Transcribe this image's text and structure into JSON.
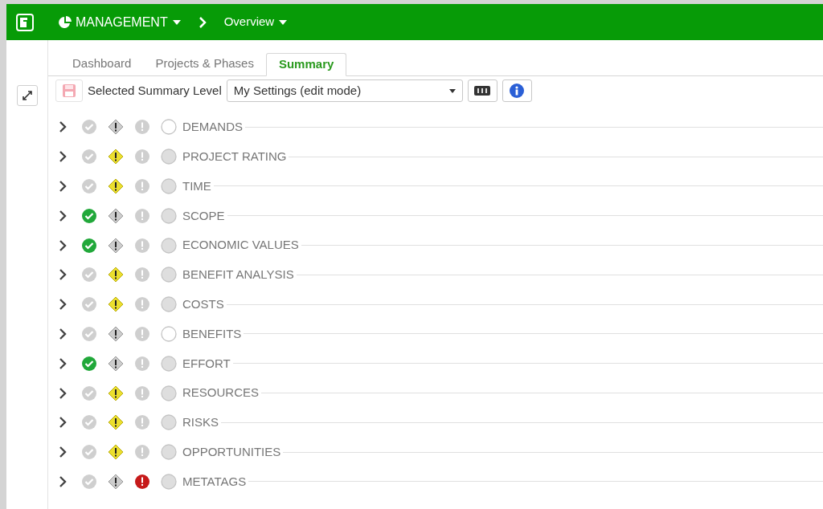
{
  "header": {
    "module": "MANAGEMENT",
    "page": "Overview"
  },
  "tabs": [
    {
      "label": "Dashboard",
      "selected": false
    },
    {
      "label": "Projects & Phases",
      "selected": false
    },
    {
      "label": "Summary",
      "selected": true
    }
  ],
  "toolbar": {
    "label": "Selected Summary Level",
    "select_value": "My Settings (edit mode)"
  },
  "rows": [
    {
      "label": "DEMANDS",
      "ok": false,
      "warning": false,
      "error": false,
      "empty": true
    },
    {
      "label": "PROJECT RATING",
      "ok": false,
      "warning": true,
      "error": false,
      "empty": false
    },
    {
      "label": "TIME",
      "ok": false,
      "warning": true,
      "error": false,
      "empty": false
    },
    {
      "label": "SCOPE",
      "ok": true,
      "warning": false,
      "error": false,
      "empty": false
    },
    {
      "label": "ECONOMIC VALUES",
      "ok": true,
      "warning": false,
      "error": false,
      "empty": false
    },
    {
      "label": "BENEFIT ANALYSIS",
      "ok": false,
      "warning": true,
      "error": false,
      "empty": false
    },
    {
      "label": "COSTS",
      "ok": false,
      "warning": true,
      "error": false,
      "empty": false
    },
    {
      "label": "BENEFITS",
      "ok": false,
      "warning": false,
      "error": false,
      "empty": true
    },
    {
      "label": "EFFORT",
      "ok": true,
      "warning": false,
      "error": false,
      "empty": false
    },
    {
      "label": "RESOURCES",
      "ok": false,
      "warning": true,
      "error": false,
      "empty": false
    },
    {
      "label": "RISKS",
      "ok": false,
      "warning": true,
      "error": false,
      "empty": false
    },
    {
      "label": "OPPORTUNITIES",
      "ok": false,
      "warning": true,
      "error": false,
      "empty": false
    },
    {
      "label": "METATAGS",
      "ok": false,
      "warning": false,
      "error": true,
      "empty": false
    }
  ]
}
